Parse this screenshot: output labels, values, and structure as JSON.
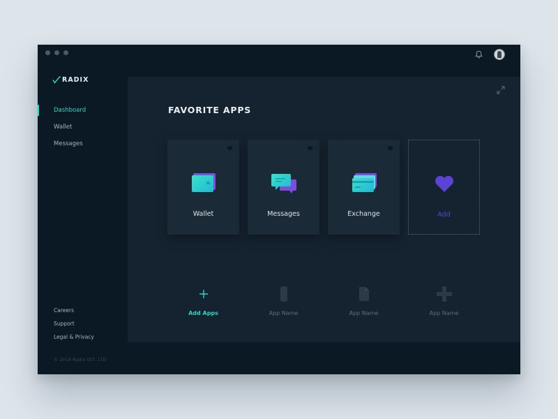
{
  "colors": {
    "accent": "#2fd3c4",
    "purple": "#5b43d6",
    "panel": "#152330",
    "window": "#0b1924"
  },
  "titlebar": {
    "icons": [
      "bell-icon",
      "avatar-icon"
    ]
  },
  "sidebar": {
    "logo": "RADIX",
    "nav": [
      {
        "label": "Dashboard",
        "active": true
      },
      {
        "label": "Wallet",
        "active": false
      },
      {
        "label": "Messages",
        "active": false
      }
    ],
    "footer": [
      "Careers",
      "Support",
      "Legal & Privacy"
    ],
    "copyright": "© 2018 Radix DLT, LTD"
  },
  "main": {
    "title": "FAVORITE APPS",
    "favorites": [
      {
        "label": "Wallet",
        "icon": "wallet-icon"
      },
      {
        "label": "Messages",
        "icon": "messages-icon"
      },
      {
        "label": "Exchange",
        "icon": "exchange-icon"
      },
      {
        "label": "Add",
        "icon": "heart-icon"
      }
    ],
    "apps": [
      {
        "label": "Add Apps",
        "icon": "plus-icon"
      },
      {
        "label": "App Name",
        "icon": "phone-icon"
      },
      {
        "label": "App Name",
        "icon": "document-icon"
      },
      {
        "label": "App Name",
        "icon": "cross-icon"
      }
    ]
  }
}
